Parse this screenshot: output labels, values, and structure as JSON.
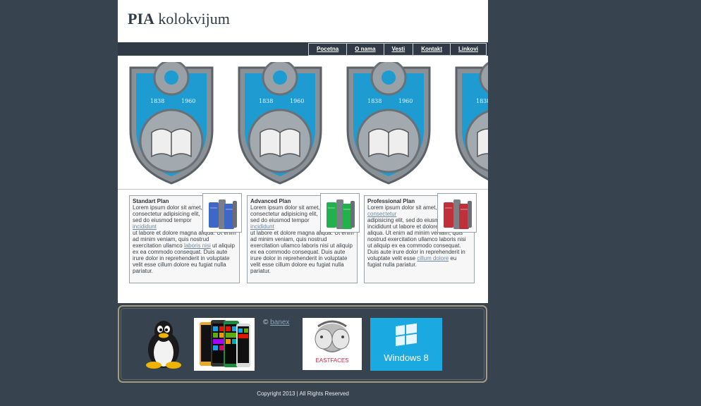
{
  "header": {
    "title_bold": "PIA",
    "title_rest": "kolokvijum"
  },
  "nav": {
    "items": [
      "Pocetna",
      "O nama",
      "Vesti",
      "Kontakt",
      "Linkovi"
    ]
  },
  "banner": {
    "crest_years": [
      "1838",
      "1960"
    ],
    "crest_icon": "gear-book-shield-icon"
  },
  "plans": [
    {
      "title": "Standart Plan",
      "t1": "Lorem ipsum dolor sit amet, consectetur adipisicing elit, sed do eiusmod tempor",
      "link1": "incididunt",
      "t2": "ut labore et dolore magna aliqua. Ut enim ad minim veniam, quis nostrud exercitation ullamco",
      "link2": "laboris nisi",
      "t3": "ut aliquip ex ea commodo consequat. Duis aute irure dolor in reprehenderit in voluptate velit esse cillum dolore eu fugiat nulla pariatur.",
      "server_color": "#3f67c7"
    },
    {
      "title": "Advanced Plan",
      "t1": "Lorem ipsum dolor sit amet, consectetur adipisicing elit, sed do eiusmod tempor",
      "link1": "incididunt",
      "t2": "ut labore et dolore magna aliqua. Ut enim ad minim veniam, quis nostrud exercitation ullamco laboris nisi ut aliquip ex ea commodo consequat. Duis aute irure dolor in reprehenderit in voluptate velit esse cillum dolore eu fugiat nulla pariatur.",
      "server_color": "#22b14c"
    },
    {
      "title": "Professional Plan",
      "t1": "Lorem ipsum dolor sit amet,",
      "link1": "consectetur",
      "t2": "adipisicing elit, sed do eiusmod tempor incididunt ut labore et dolore magna aliqua. Ut enim ad minim veniam, quis nostrud exercitation ullamco laboris nisi ut aliquip ex ea commodo consequat. Duis aute irure dolor in reprehenderit in voluptate velit esse",
      "link2": "cillum dolore",
      "t3": "eu fugiat nulla pariatur.",
      "server_color": "#c0303a"
    }
  ],
  "footer": {
    "copy_symbol": "©",
    "banex_link": "banex",
    "logos": [
      "linux-tux-icon",
      "windows-phones-icon",
      "eastfaces-logo",
      "windows-8-logo"
    ],
    "eastfaces_text": "EASTFACES",
    "windows8_text": "Windows 8",
    "copyright": "Copyright 2013 | All Rights Reserved"
  }
}
